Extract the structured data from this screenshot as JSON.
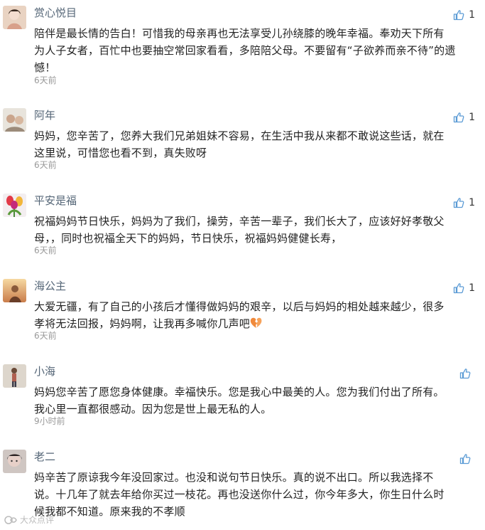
{
  "comments": [
    {
      "username": "赏心悦目",
      "line1": "陪伴是最长情的告白！可惜我的母亲再也无法享受儿孙绕膝的晚年幸福。奉劝天下所有",
      "line2": "为人子女者，百忙中也要抽空常回家看看，多陪陪父母。不要留有“子欲养而亲不待”的遗",
      "line3": "憾！",
      "time": "6天前",
      "likes": "1"
    },
    {
      "username": "阿年",
      "line1": "妈妈，您辛苦了，您养大我们兄弟姐妹不容易，在生活中我从来都不敢说这些话，就在",
      "line2": "这里说，可惜您也看不到，真失败呀",
      "time": "6天前",
      "likes": "1"
    },
    {
      "username": "平安是福",
      "line1": "祝福妈妈节日快乐，妈妈为了我们，操劳，辛苦一辈子，我们长大了，应该好好孝敬父",
      "line2": "母，，同时也祝福全天下的妈妈，节日快乐，祝福妈妈健健长寿，",
      "time": "6天前",
      "likes": "1"
    },
    {
      "username": "海公主",
      "line1": "大爱无疆，有了自己的小孩后才懂得做妈妈的艰辛，以后与妈妈的相处越来越少，很多",
      "line2": "孝将无法回报，妈妈啊，让我再多喊你几声吧",
      "emoji": "broken-heart-icon",
      "time": "6天前",
      "likes": "1"
    },
    {
      "username": "小海",
      "line1": "妈妈您辛苦了愿您身体健康。幸福快乐。您是我心中最美的人。您为我们付出了所有。",
      "line2": "我心里一直都很感动。因为您是世上最无私的人。",
      "time": "9小时前",
      "likes": ""
    },
    {
      "username": "老二",
      "line1": "妈辛苦了原谅我今年没回家过。也没和说句节日快乐。真的说不出口。所以我选择不",
      "line2": "说。十几年了就去年给你买过一枝花。再也没送你什么过，你今年多大，你生日什么时",
      "line3": "候我都不知道。原来我的不孝顺",
      "likes": ""
    }
  ],
  "watermark": "大众点评",
  "colors": {
    "username": "#556677",
    "time": "#9a9a9a",
    "like_icon": "#5b9bd5",
    "heart": "#f08a3c"
  },
  "icons": {
    "like": "thumbs-up-icon",
    "emoji": "broken-heart-icon"
  }
}
